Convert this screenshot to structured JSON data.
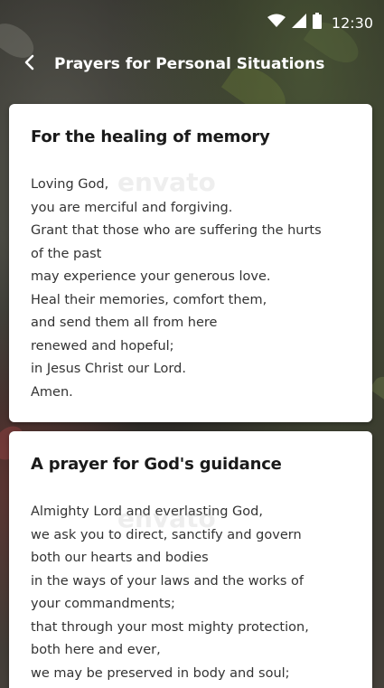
{
  "status_bar": {
    "time": "12:30",
    "icons": [
      "wifi-icon",
      "cellular-signal-icon",
      "battery-icon"
    ]
  },
  "app_bar": {
    "back_icon": "chevron-left-icon",
    "title": "Prayers for Personal Situations"
  },
  "watermark": "envato",
  "cards": [
    {
      "title": "For the healing of memory",
      "lines": [
        "Loving God,",
        "you are merciful and forgiving.",
        "Grant that those who are suffering the hurts",
        "of the past",
        "may experience your generous love.",
        "Heal their memories, comfort them,",
        "and send them all from here",
        "renewed and hopeful;",
        "in Jesus Christ our Lord.",
        "Amen."
      ]
    },
    {
      "title": "A prayer for God's guidance",
      "lines": [
        "Almighty Lord and everlasting God,",
        "we ask you to direct, sanctify and govern",
        "both our hearts and bodies",
        "in the ways of your laws and the works of",
        "your commandments;",
        "that through your most mighty protection,",
        "both here and ever,",
        "we may be preserved in body and soul;"
      ]
    }
  ],
  "colors": {
    "card_background": "#ffffff",
    "title_text": "#1a1a1a",
    "body_text": "#333333",
    "app_bar_text": "#ffffff"
  }
}
